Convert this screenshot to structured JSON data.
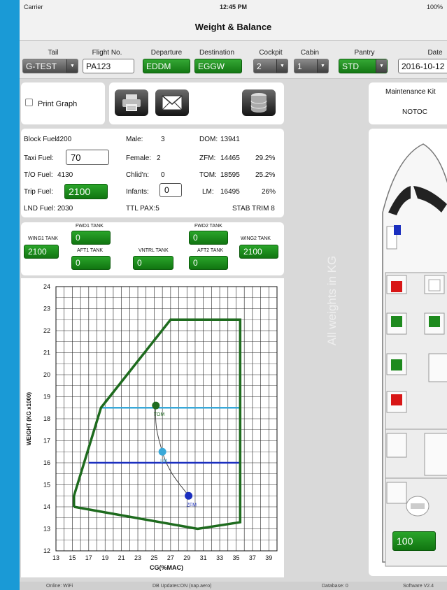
{
  "status": {
    "carrier": "Carrier",
    "time": "12:45 PM",
    "battery": "100%"
  },
  "title": "Weight & Balance",
  "inputs": {
    "tail_label": "Tail",
    "tail_value": "G-TEST",
    "flight_label": "Flight No.",
    "flight_value": "PA123",
    "departure_label": "Departure",
    "departure_value": "EDDM",
    "destination_label": "Destination",
    "destination_value": "EGGW",
    "cockpit_label": "Cockpit",
    "cockpit_value": "2",
    "cabin_label": "Cabin",
    "cabin_value": "1",
    "pantry_label": "Pantry",
    "pantry_value": "STD",
    "date_label": "Date",
    "date_value": "2016-10-12"
  },
  "print": {
    "label": "Print Graph"
  },
  "maintenance": {
    "label": "Maintenance Kit",
    "value": "NOTOC"
  },
  "fuel": {
    "block_label": "Block Fuel:",
    "block_value": "4200",
    "taxi_label": "Taxi Fuel:",
    "taxi_value": "70",
    "to_label": "T/O Fuel:",
    "to_value": "4130",
    "trip_label": "Trip Fuel:",
    "trip_value": "2100",
    "lnd_label": "LND Fuel:",
    "lnd_value": "2030"
  },
  "pax": {
    "male_label": "Male:",
    "male_value": "3",
    "female_label": "Female:",
    "female_value": "2",
    "child_label": "Chlid'n:",
    "child_value": "0",
    "infant_label": "Infants:",
    "infant_value": "0",
    "total": "TTL PAX:5"
  },
  "weights": {
    "dom_label": "DOM:",
    "dom_value": "13941",
    "zfm_label": "ZFM:",
    "zfm_value": "14465",
    "zfm_pct": "29.2%",
    "tom_label": "TOM:",
    "tom_value": "18595",
    "tom_pct": "25.2%",
    "lm_label": "LM:",
    "lm_value": "16495",
    "lm_pct": "26%",
    "stab": "STAB TRIM 8"
  },
  "tanks": {
    "wing1_label": "WING1 TANK",
    "wing1_value": "2100",
    "fwd1_label": "FWD1 TANK",
    "fwd1_value": "0",
    "aft1_label": "AFT1 TANK",
    "aft1_value": "0",
    "vntrl_label": "VNTRL TANK",
    "vntrl_value": "0",
    "fwd2_label": "FWD2 TANK",
    "fwd2_value": "0",
    "aft2_label": "AFT2 TANK",
    "aft2_value": "0",
    "wing2_label": "WING2 TANK",
    "wing2_value": "2100"
  },
  "watermark": "All weights in KG",
  "cargo_value": "100",
  "bottom": {
    "online": "Online: WiFi",
    "db_updates": "DB Updates:ON   (nap.aero)",
    "database": "Database: 0",
    "software": "Software V2.4"
  },
  "colors": {
    "green": "#1e8a1e",
    "envelope": "#1e6b1e",
    "tom_line": "#39a8d8",
    "lm_line": "#1b2fbf",
    "tom_dot": "#1e6b1e",
    "lm_dot": "#39a8d8",
    "zfm_dot": "#1b2fbf"
  },
  "chart_data": {
    "type": "scatter",
    "xlabel": "CG(%MAC)",
    "ylabel": "WEIGHT (KG x1000)",
    "xlim": [
      13,
      40
    ],
    "ylim": [
      12,
      24
    ],
    "x_ticks": [
      "13",
      "15",
      "17",
      "19",
      "21",
      "23",
      "25",
      "27",
      "29",
      "31",
      "33",
      "35",
      "37",
      "39"
    ],
    "y_ticks": [
      "12",
      "13",
      "14",
      "15",
      "16",
      "17",
      "18",
      "19",
      "20",
      "21",
      "22",
      "23",
      "24"
    ],
    "envelope": [
      [
        15.2,
        14.0
      ],
      [
        15.2,
        14.5
      ],
      [
        18.5,
        18.5
      ],
      [
        27.0,
        22.5
      ],
      [
        35.5,
        22.5
      ],
      [
        35.5,
        13.3
      ],
      [
        30.3,
        13.0
      ],
      [
        15.2,
        14.0
      ]
    ],
    "tom_limit_line": {
      "x": [
        18.5,
        35.5
      ],
      "y": [
        18.5,
        18.5
      ]
    },
    "lm_limit_line": {
      "x": [
        17.0,
        35.5
      ],
      "y": [
        16.0,
        16.0
      ]
    },
    "points": [
      {
        "label": "TOM",
        "x": 25.2,
        "y": 18.6
      },
      {
        "label": "LM",
        "x": 26.0,
        "y": 16.5
      },
      {
        "label": "ZFM",
        "x": 29.2,
        "y": 14.5
      }
    ]
  }
}
